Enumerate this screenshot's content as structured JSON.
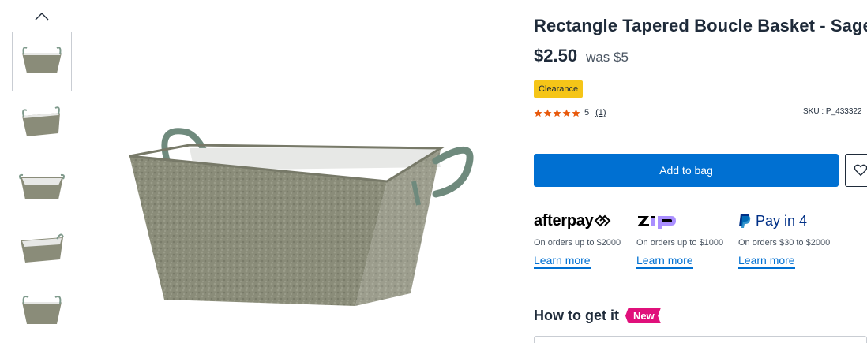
{
  "gallery": {
    "thumbnails": [
      {
        "label": "thumbnail-1",
        "selected": true
      },
      {
        "label": "thumbnail-2",
        "selected": false
      },
      {
        "label": "thumbnail-3",
        "selected": false
      },
      {
        "label": "thumbnail-4",
        "selected": false
      },
      {
        "label": "thumbnail-5",
        "selected": false
      }
    ],
    "colors": {
      "basket": "#8a8c79",
      "basket_dark": "#6f7262",
      "liner": "#e7e8e6",
      "handle": "#7f9a8c"
    }
  },
  "product": {
    "title": "Rectangle Tapered Boucle Basket - Sage",
    "price": "$2.50",
    "was_price": "was $5",
    "badge": "Clearance",
    "rating_value": "5",
    "rating_count": "(1)",
    "sku": "SKU : P_433322"
  },
  "actions": {
    "add_to_bag": "Add to bag"
  },
  "payments": [
    {
      "brand": "afterpay",
      "description": "On orders up to $2000",
      "link": "Learn more"
    },
    {
      "brand": "zip",
      "description": "On orders up to $1000",
      "link": "Learn more"
    },
    {
      "brand": "Pay in 4",
      "description": "On orders $30 to $2000",
      "link": "Learn more"
    }
  ],
  "delivery": {
    "title": "How to get it",
    "new_badge": "New"
  },
  "colors": {
    "primary": "#0070d2",
    "badge_yellow": "#f5c518",
    "star": "#e8590c",
    "new_pink": "#e0107b",
    "text": "#1f2b3a"
  }
}
